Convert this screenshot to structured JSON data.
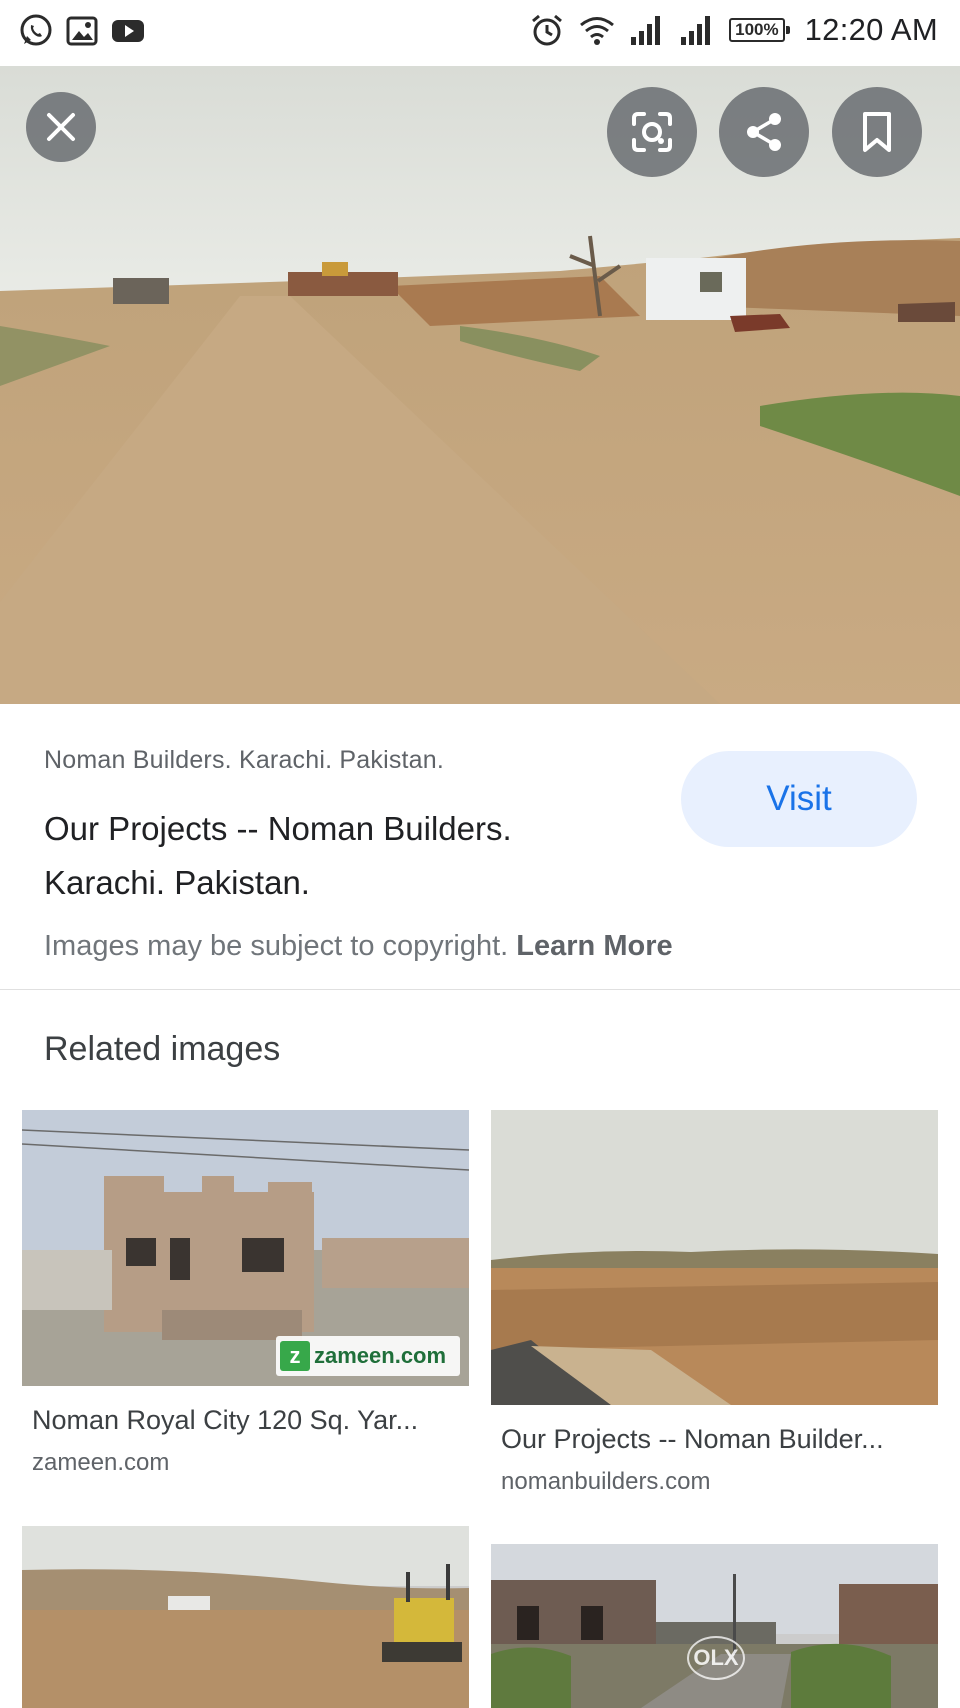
{
  "status_bar": {
    "time": "12:20 AM",
    "battery": "100%",
    "left_icons": [
      "whatsapp-icon",
      "gallery-icon",
      "youtube-icon"
    ],
    "right_icons": [
      "alarm-icon",
      "wifi-icon",
      "signal-icon",
      "signal-icon",
      "battery-icon"
    ]
  },
  "viewer": {
    "buttons": [
      "close-icon",
      "lens-icon",
      "share-icon",
      "bookmark-icon"
    ]
  },
  "result": {
    "source": "Noman Builders. Karachi. Pakistan.",
    "title": "Our Projects -- Noman Builders. Karachi. Pakistan.",
    "visit_label": "Visit",
    "copyright_text": "Images may be subject to copyright.",
    "learn_more": "Learn More"
  },
  "related": {
    "heading": "Related images",
    "items": [
      {
        "title": "Noman Royal City 120 Sq. Yar...",
        "domain": "zameen.com",
        "watermark": "zameen.com"
      },
      {
        "title": "Our Projects -- Noman Builder...",
        "domain": "nomanbuilders.com"
      },
      {
        "title": "",
        "domain": ""
      },
      {
        "title": "",
        "domain": "",
        "watermark": "OLX"
      }
    ]
  },
  "colors": {
    "accent": "#1a73e8",
    "visit_bg": "#e8f0fe",
    "overlay_button": "#5f6368"
  }
}
